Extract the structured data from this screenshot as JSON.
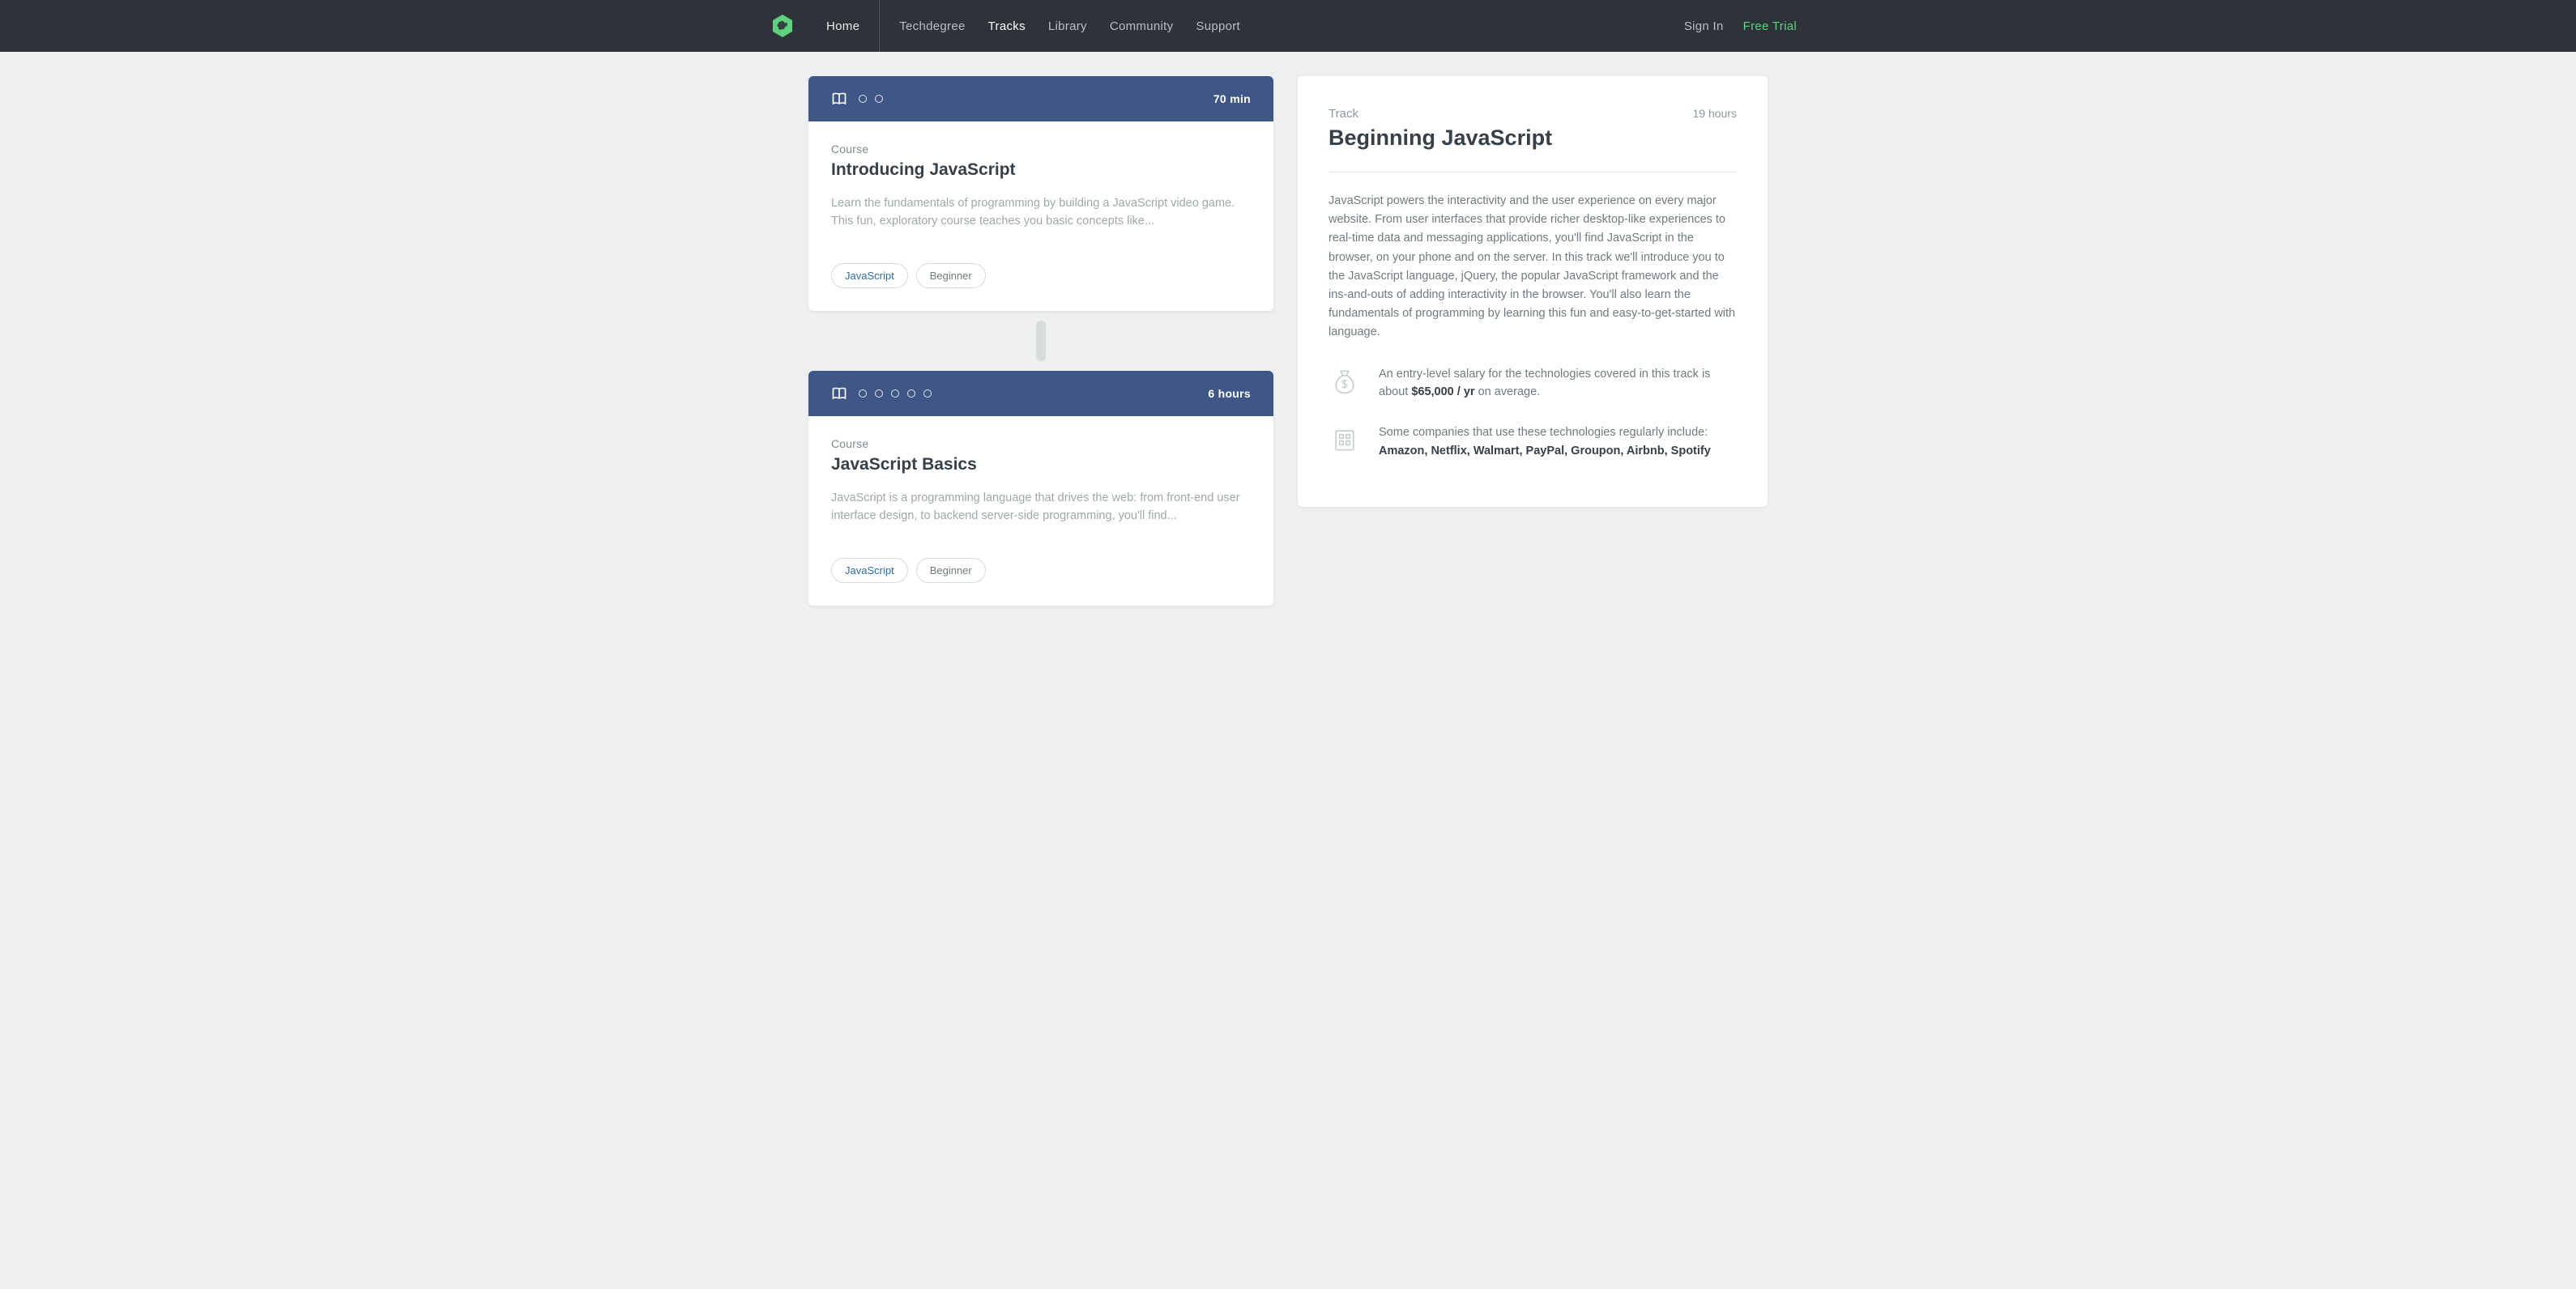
{
  "nav": {
    "home": "Home",
    "items": [
      "Techdegree",
      "Tracks",
      "Library",
      "Community",
      "Support"
    ],
    "active_index": 1,
    "signin": "Sign In",
    "free_trial": "Free Trial"
  },
  "courses": [
    {
      "duration": "70 min",
      "dots": 2,
      "label": "Course",
      "title": "Introducing JavaScript",
      "description": "Learn the fundamentals of programming by building a JavaScript video game. This fun, exploratory course teaches you basic concepts like...",
      "tags": [
        "JavaScript",
        "Beginner"
      ]
    },
    {
      "duration": "6 hours",
      "dots": 5,
      "label": "Course",
      "title": "JavaScript Basics",
      "description": "JavaScript is a programming language that drives the web: from front-end user interface design, to backend server-side programming, you'll find...",
      "tags": [
        "JavaScript",
        "Beginner"
      ]
    }
  ],
  "track": {
    "label": "Track",
    "title": "Beginning JavaScript",
    "hours": "19 hours",
    "description": "JavaScript powers the interactivity and the user experience on every major website. From user interfaces that provide richer desktop-like experiences to real-time data and messaging applications, you'll find JavaScript in the browser, on your phone and on the server. In this track we'll introduce you to the JavaScript language, jQuery, the popular JavaScript framework and the ins-and-outs of adding interactivity in the browser. You'll also learn the fundamentals of programming by learning this fun and easy-to-get-started with language.",
    "salary_prefix": "An entry-level salary for the technologies covered in this track is about ",
    "salary_value": "$65,000 / yr",
    "salary_suffix": " on average.",
    "companies_prefix": "Some companies that use these technologies regularly include: ",
    "companies_value": "Amazon, Netflix, Walmart, PayPal, Groupon, Airbnb, Spotify"
  }
}
